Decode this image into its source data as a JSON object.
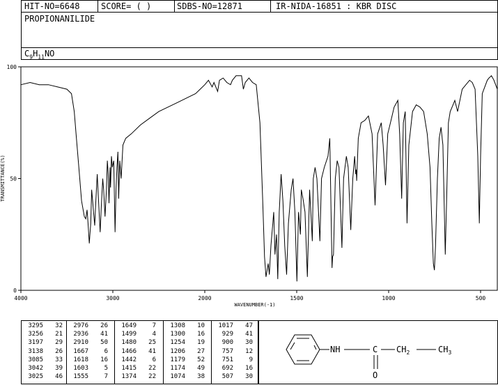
{
  "header": {
    "hit_no": "HIT-NO=6648",
    "score": "SCORE=  (   )",
    "sdbs_no": "SDBS-NO=12871",
    "ir_info": "IR-NIDA-16851 : KBR DISC",
    "compound_name": "PROPIONANILIDE",
    "formula_c": "C",
    "formula_c_sub": "9",
    "formula_h": "H",
    "formula_h_sub": "11",
    "formula_rest": "NO"
  },
  "structure": {
    "nh": "NH",
    "c": "C",
    "ch2": "CH",
    "ch2_sub": "2",
    "ch3": "CH",
    "ch3_sub": "3",
    "o": "O"
  },
  "peak_table": {
    "columns": [
      [
        [
          "3295",
          "32"
        ],
        [
          "3256",
          "21"
        ],
        [
          "3197",
          "29"
        ],
        [
          "3138",
          "26"
        ],
        [
          "3085",
          "33"
        ],
        [
          "3042",
          "39"
        ],
        [
          "3025",
          "46"
        ]
      ],
      [
        [
          "2976",
          "26"
        ],
        [
          "2936",
          "41"
        ],
        [
          "2910",
          "50"
        ],
        [
          "1667",
          "6"
        ],
        [
          "1618",
          "16"
        ],
        [
          "1603",
          "5"
        ],
        [
          "1555",
          "7"
        ]
      ],
      [
        [
          "1649",
          "7"
        ],
        [
          "1499",
          "4"
        ],
        [
          "1480",
          "25"
        ],
        [
          "1466",
          "41"
        ],
        [
          "1442",
          "6"
        ],
        [
          "1415",
          "22"
        ],
        [
          "1374",
          "22"
        ]
      ],
      [
        [
          "1308",
          "10"
        ],
        [
          "1300",
          "16"
        ],
        [
          "1254",
          "19"
        ],
        [
          "1206",
          "27"
        ],
        [
          "1179",
          "52"
        ],
        [
          "1174",
          "49"
        ],
        [
          "1074",
          "38"
        ]
      ],
      [
        [
          "1017",
          "47"
        ],
        [
          "929",
          "41"
        ],
        [
          "900",
          "30"
        ],
        [
          "757",
          "12"
        ],
        [
          "751",
          "9"
        ],
        [
          "692",
          "16"
        ],
        [
          "507",
          "30"
        ]
      ]
    ]
  },
  "chart_data": {
    "type": "line",
    "title": "",
    "xlabel": "WAVENUMBER(-1)",
    "ylabel": "TRANSMITTANCE(%)",
    "xlim": [
      4000,
      400
    ],
    "ylim": [
      0,
      100
    ],
    "x_ticks": [
      "4000",
      "3000",
      "2000",
      "1500",
      "1000",
      "500"
    ],
    "y_ticks": [
      "100",
      "50",
      "0"
    ],
    "grid": false,
    "series": [
      {
        "name": "",
        "color": "#000000",
        "points": [
          [
            4000,
            92
          ],
          [
            3900,
            93
          ],
          [
            3800,
            92
          ],
          [
            3700,
            92
          ],
          [
            3600,
            91
          ],
          [
            3500,
            90
          ],
          [
            3450,
            88
          ],
          [
            3420,
            80
          ],
          [
            3400,
            70
          ],
          [
            3370,
            55
          ],
          [
            3340,
            40
          ],
          [
            3310,
            33
          ],
          [
            3295,
            32
          ],
          [
            3280,
            36
          ],
          [
            3270,
            30
          ],
          [
            3256,
            21
          ],
          [
            3240,
            30
          ],
          [
            3230,
            45
          ],
          [
            3220,
            40
          ],
          [
            3210,
            35
          ],
          [
            3197,
            29
          ],
          [
            3185,
            40
          ],
          [
            3170,
            52
          ],
          [
            3155,
            40
          ],
          [
            3138,
            26
          ],
          [
            3125,
            38
          ],
          [
            3110,
            50
          ],
          [
            3100,
            45
          ],
          [
            3085,
            33
          ],
          [
            3070,
            45
          ],
          [
            3060,
            58
          ],
          [
            3050,
            52
          ],
          [
            3042,
            39
          ],
          [
            3030,
            55
          ],
          [
            3025,
            46
          ],
          [
            3015,
            60
          ],
          [
            3005,
            55
          ],
          [
            2990,
            58
          ],
          [
            2976,
            26
          ],
          [
            2965,
            45
          ],
          [
            2955,
            55
          ],
          [
            2945,
            62
          ],
          [
            2936,
            41
          ],
          [
            2925,
            58
          ],
          [
            2910,
            50
          ],
          [
            2890,
            65
          ],
          [
            2860,
            68
          ],
          [
            2800,
            70
          ],
          [
            2700,
            74
          ],
          [
            2600,
            77
          ],
          [
            2500,
            80
          ],
          [
            2400,
            82
          ],
          [
            2300,
            84
          ],
          [
            2200,
            86
          ],
          [
            2100,
            88
          ],
          [
            2050,
            90
          ],
          [
            2000,
            92
          ],
          [
            1980,
            94
          ],
          [
            1960,
            91
          ],
          [
            1950,
            93
          ],
          [
            1930,
            89
          ],
          [
            1920,
            94
          ],
          [
            1900,
            95
          ],
          [
            1880,
            93
          ],
          [
            1860,
            92
          ],
          [
            1850,
            94
          ],
          [
            1830,
            96
          ],
          [
            1800,
            96
          ],
          [
            1790,
            90
          ],
          [
            1780,
            93
          ],
          [
            1760,
            95
          ],
          [
            1740,
            93
          ],
          [
            1720,
            92
          ],
          [
            1700,
            75
          ],
          [
            1685,
            40
          ],
          [
            1675,
            15
          ],
          [
            1667,
            6
          ],
          [
            1655,
            12
          ],
          [
            1649,
            7
          ],
          [
            1640,
            20
          ],
          [
            1630,
            30
          ],
          [
            1625,
            35
          ],
          [
            1618,
            16
          ],
          [
            1610,
            25
          ],
          [
            1603,
            5
          ],
          [
            1595,
            35
          ],
          [
            1585,
            52
          ],
          [
            1575,
            40
          ],
          [
            1565,
            20
          ],
          [
            1555,
            7
          ],
          [
            1545,
            30
          ],
          [
            1530,
            45
          ],
          [
            1520,
            50
          ],
          [
            1510,
            35
          ],
          [
            1499,
            4
          ],
          [
            1490,
            35
          ],
          [
            1480,
            25
          ],
          [
            1475,
            45
          ],
          [
            1466,
            41
          ],
          [
            1455,
            35
          ],
          [
            1442,
            6
          ],
          [
            1430,
            45
          ],
          [
            1420,
            30
          ],
          [
            1415,
            22
          ],
          [
            1410,
            50
          ],
          [
            1400,
            55
          ],
          [
            1390,
            50
          ],
          [
            1374,
            22
          ],
          [
            1365,
            50
          ],
          [
            1350,
            55
          ],
          [
            1330,
            60
          ],
          [
            1320,
            68
          ],
          [
            1308,
            10
          ],
          [
            1305,
            15
          ],
          [
            1300,
            16
          ],
          [
            1290,
            50
          ],
          [
            1280,
            58
          ],
          [
            1270,
            55
          ],
          [
            1254,
            19
          ],
          [
            1245,
            50
          ],
          [
            1230,
            60
          ],
          [
            1220,
            55
          ],
          [
            1206,
            27
          ],
          [
            1195,
            50
          ],
          [
            1185,
            60
          ],
          [
            1179,
            52
          ],
          [
            1176,
            54
          ],
          [
            1174,
            49
          ],
          [
            1165,
            68
          ],
          [
            1150,
            75
          ],
          [
            1130,
            76
          ],
          [
            1110,
            78
          ],
          [
            1090,
            70
          ],
          [
            1074,
            38
          ],
          [
            1060,
            70
          ],
          [
            1040,
            75
          ],
          [
            1030,
            65
          ],
          [
            1017,
            47
          ],
          [
            1005,
            70
          ],
          [
            990,
            75
          ],
          [
            970,
            82
          ],
          [
            950,
            85
          ],
          [
            940,
            70
          ],
          [
            929,
            41
          ],
          [
            920,
            75
          ],
          [
            910,
            80
          ],
          [
            900,
            30
          ],
          [
            890,
            65
          ],
          [
            870,
            80
          ],
          [
            850,
            83
          ],
          [
            830,
            82
          ],
          [
            810,
            80
          ],
          [
            790,
            70
          ],
          [
            775,
            55
          ],
          [
            765,
            30
          ],
          [
            757,
            12
          ],
          [
            751,
            9
          ],
          [
            745,
            20
          ],
          [
            735,
            50
          ],
          [
            725,
            68
          ],
          [
            715,
            73
          ],
          [
            705,
            65
          ],
          [
            692,
            16
          ],
          [
            685,
            40
          ],
          [
            675,
            75
          ],
          [
            665,
            80
          ],
          [
            655,
            82
          ],
          [
            640,
            85
          ],
          [
            625,
            80
          ],
          [
            600,
            90
          ],
          [
            580,
            92
          ],
          [
            560,
            94
          ],
          [
            545,
            93
          ],
          [
            530,
            90
          ],
          [
            515,
            60
          ],
          [
            507,
            30
          ],
          [
            500,
            60
          ],
          [
            490,
            88
          ],
          [
            480,
            90
          ],
          [
            470,
            92
          ],
          [
            460,
            94
          ],
          [
            450,
            95
          ],
          [
            435,
            96
          ],
          [
            420,
            94
          ],
          [
            400,
            90
          ]
        ]
      }
    ]
  }
}
